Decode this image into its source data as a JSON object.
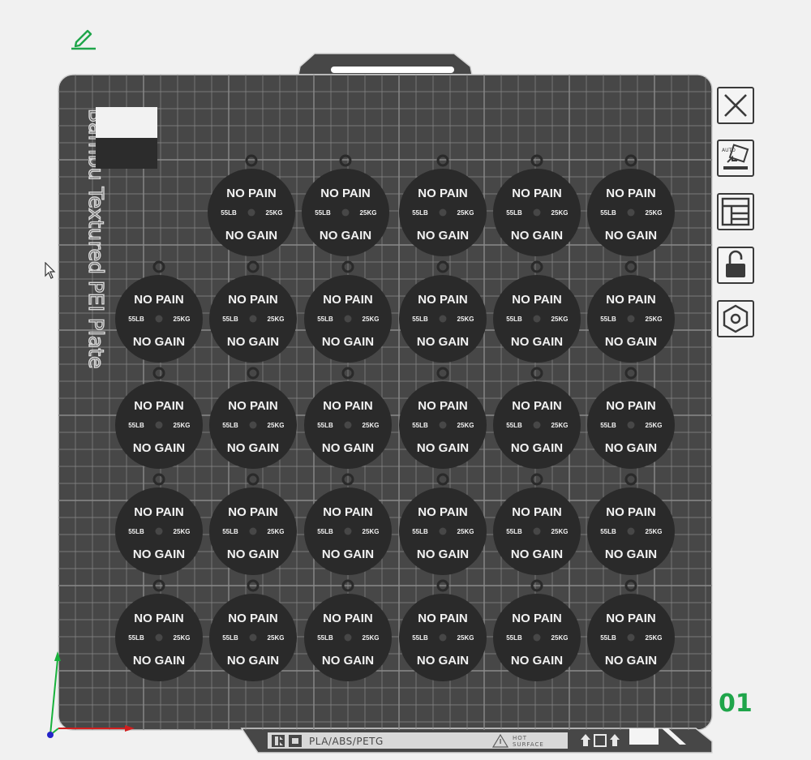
{
  "plate": {
    "brand_text": "Bambu Textured PEI Plate",
    "material_label": "PLA/ABS/PETG",
    "warning_label_line1": "HOT",
    "warning_label_line2": "SURFACE",
    "plate_number": "01"
  },
  "medallion": {
    "top_text": "NO PAIN",
    "bottom_text": "NO GAIN",
    "left_text": "55LB",
    "right_text": "25KG"
  },
  "medallion_rows": [
    5,
    6,
    6,
    6,
    6
  ],
  "toolbar": [
    {
      "name": "close-button",
      "icon": "x-icon"
    },
    {
      "name": "auto-orient-button",
      "icon": "auto-orient-icon"
    },
    {
      "name": "arrange-button",
      "icon": "arrange-layout-icon"
    },
    {
      "name": "lock-button",
      "icon": "unlocked-padlock-icon"
    },
    {
      "name": "plate-settings-button",
      "icon": "hex-nut-icon"
    }
  ],
  "colors": {
    "plate": "#474747",
    "grid": "#8a8a8a",
    "medallion": "#2a2a2a",
    "axis_x": "#d21e1e",
    "axis_y": "#18b23c",
    "axis_z": "#2424c8",
    "accent": "#1fa54a"
  }
}
